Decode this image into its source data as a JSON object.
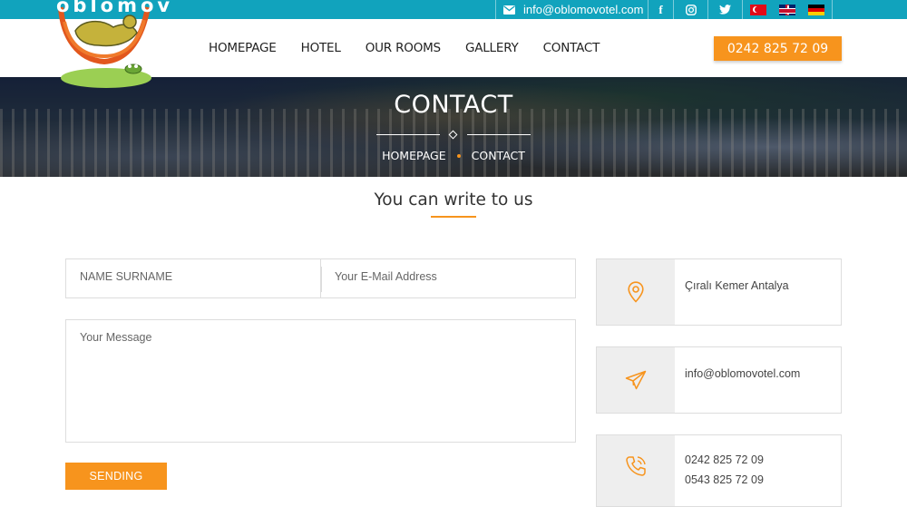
{
  "topbar": {
    "email": "info@oblomovotel.com",
    "social": [
      "facebook-icon",
      "instagram-icon",
      "twitter-icon"
    ],
    "facebook_glyph": "f",
    "languages": [
      "tr",
      "en",
      "de"
    ]
  },
  "logo": {
    "text": "oblomov"
  },
  "nav": {
    "items": [
      "HOMEPAGE",
      "HOTEL",
      "OUR ROOMS",
      "GALLERY",
      "CONTACT"
    ],
    "phone": "0242 825 72 09"
  },
  "hero": {
    "title": "CONTACT",
    "breadcrumb": [
      "HOMEPAGE",
      "CONTACT"
    ]
  },
  "section": {
    "title": "You can write to us"
  },
  "form": {
    "name_placeholder": "NAME SURNAME",
    "email_placeholder": "Your E-Mail Address",
    "message_placeholder": "Your Message",
    "submit_label": "SENDING"
  },
  "info": {
    "address": "Çıralı Kemer Antalya",
    "email": "info@oblomovotel.com",
    "phones": [
      "0242 825 72 09",
      "0543 825 72 09"
    ]
  },
  "colors": {
    "topbar": "#11a3bd",
    "accent": "#f7941d",
    "icon_bg": "#eeeeee"
  }
}
